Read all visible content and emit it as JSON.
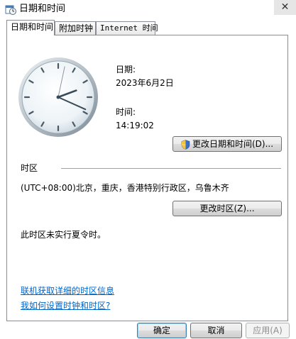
{
  "window": {
    "title": "日期和时间",
    "close_glyph": "✕"
  },
  "tabs": [
    {
      "label": "日期和时间",
      "active": true
    },
    {
      "label": "附加时钟",
      "active": false
    },
    {
      "label": "Internet 时间",
      "active": false
    }
  ],
  "date_section": {
    "date_label": "日期:",
    "date_value": "2023年6月2日",
    "time_label": "时间:",
    "time_value": "14:19:02",
    "change_button": "更改日期和时间(D)..."
  },
  "timezone_section": {
    "heading": "时区",
    "value": "(UTC+08:00)北京，重庆，香港特别行政区，乌鲁木齐",
    "change_button": "更改时区(Z)...",
    "dst_note": "此时区未实行夏令时。"
  },
  "links": {
    "details": "联机获取详细的时区信息",
    "how_to": "我如何设置时钟和时区?"
  },
  "footer": {
    "ok": "确定",
    "cancel": "取消",
    "apply": "应用(A)"
  },
  "icons": {
    "title": "clock-calendar-icon",
    "shield": "uac-shield-icon"
  },
  "colors": {
    "link": "#0066cc",
    "default_button_border": "#3c7fb1"
  }
}
